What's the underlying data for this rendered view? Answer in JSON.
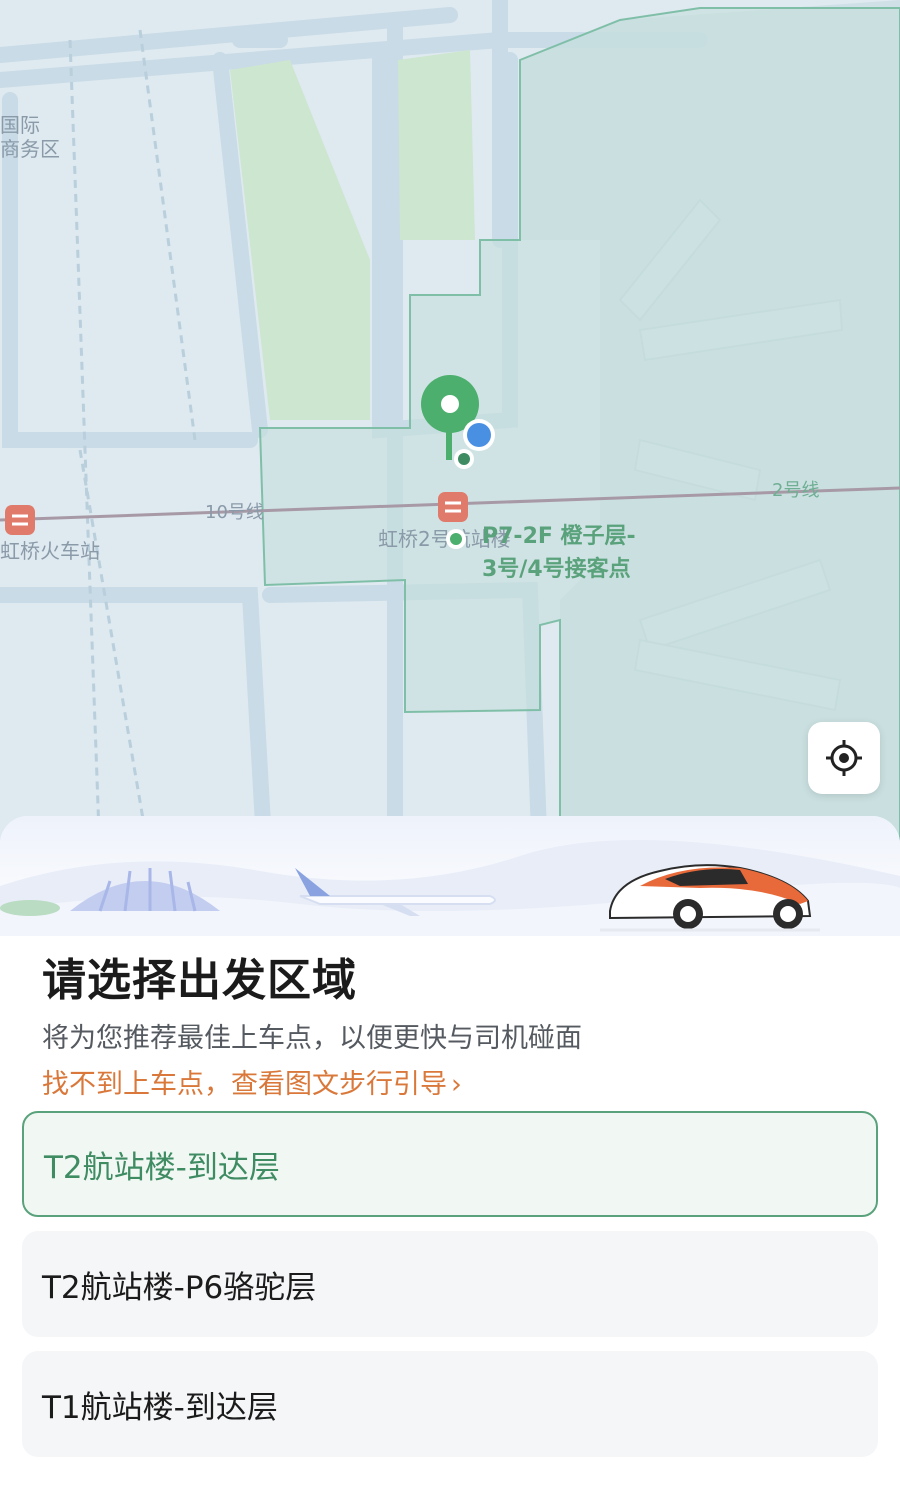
{
  "map": {
    "labels": {
      "intl_business_line1": "国际",
      "intl_business_line2": "商务区",
      "line10": "10号线",
      "line2": "2号线",
      "station_left": "虹桥火车站",
      "station_terminal": "虹桥2号航站楼",
      "pickup_line1": "P7-2F 橙子层-",
      "pickup_line2": "3号/4号接客点"
    },
    "icons": {
      "metro": "metro-station-icon",
      "pin": "pickup-pin-icon",
      "user": "user-location-dot-icon"
    },
    "colors": {
      "map_bg": "#dfe9f0",
      "road": "#c9dbe6",
      "zone_fill": "#cfe3e2",
      "zone_stroke": "#7fbfa8",
      "green_area": "#cde6cf",
      "pin": "#4caf6d",
      "user_dot": "#4a90e2",
      "metro_badge": "#e07a6b"
    }
  },
  "locate_button": {
    "icon": "crosshair-icon"
  },
  "sheet": {
    "title": "请选择出发区域",
    "subtitle": "将为您推荐最佳上车点，以便更快与司机碰面",
    "guide_link": "找不到上车点，查看图文步行引导",
    "guide_chevron": "›",
    "options": [
      {
        "label": "T2航站楼-到达层",
        "selected": true
      },
      {
        "label": "T2航站楼-P6骆驼层",
        "selected": false
      },
      {
        "label": "T1航站楼-到达层",
        "selected": false
      }
    ],
    "colors": {
      "accent_green": "#3f8c63",
      "link_orange": "#d9783a",
      "car_orange": "#e8693a"
    }
  }
}
